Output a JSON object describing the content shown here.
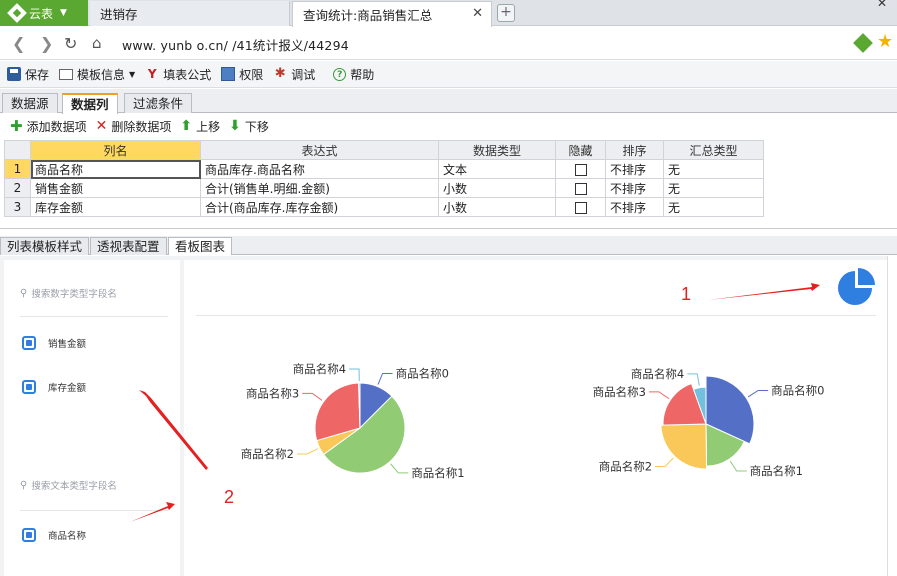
{
  "browser": {
    "app_name": "云表",
    "tabs": [
      {
        "label": "进销存"
      },
      {
        "label": "查询统计:商品销售汇总"
      }
    ],
    "url": "www.    yunb    o.cn/    /41统计报义/44294"
  },
  "toolbar": {
    "save": "保存",
    "template_info": "模板信息",
    "fill_formula": "填表公式",
    "permissions": "权限",
    "debug": "调试",
    "help": "帮助"
  },
  "design_tabs": [
    "数据源",
    "数据列",
    "过滤条件"
  ],
  "column_actions": {
    "add": "添加数据项",
    "delete": "删除数据项",
    "move_up": "上移",
    "move_down": "下移"
  },
  "grid": {
    "headers": [
      "列名",
      "表达式",
      "数据类型",
      "隐藏",
      "排序",
      "汇总类型"
    ],
    "rows": [
      {
        "num": "1",
        "name": "商品名称",
        "expr": "商品库存.商品名称",
        "type": "文本",
        "sort": "不排序",
        "agg": "无"
      },
      {
        "num": "2",
        "name": "销售金额",
        "expr": "合计(销售单.明细.金额)",
        "type": "小数",
        "sort": "不排序",
        "agg": "无"
      },
      {
        "num": "3",
        "name": "库存金额",
        "expr": "合计(商品库存.库存金额)",
        "type": "小数",
        "sort": "不排序",
        "agg": "无"
      }
    ]
  },
  "bottom_tabs": [
    "列表模板样式",
    "透视表配置",
    "看板图表"
  ],
  "board": {
    "numeric_search_placeholder": "搜索数字类型字段名",
    "numeric_fields": [
      "销售金额",
      "库存金额"
    ],
    "text_search_placeholder": "搜索文本类型字段名",
    "text_fields": [
      "商品名称"
    ]
  },
  "annotations": [
    "1",
    "2"
  ],
  "colors": {
    "accent_green": "#5aa832",
    "pie_blue": "#5470c6",
    "pie_green": "#91cc75",
    "pie_yellow": "#fac858",
    "pie_red": "#ee6666",
    "pie_cyan": "#73c0de",
    "icon_blue": "#2f7fe0",
    "annotation_red": "#e42020"
  },
  "chart_data": [
    {
      "type": "pie",
      "categories": [
        "商品名称0",
        "商品名称1",
        "商品名称2",
        "商品名称3",
        "商品名称4"
      ],
      "values": [
        12.5,
        52.5,
        5.5,
        29,
        0.5
      ]
    },
    {
      "type": "pie",
      "categories": [
        "商品名称0",
        "商品名称1",
        "商品名称2",
        "商品名称3",
        "商品名称4"
      ],
      "values": [
        31.8,
        18,
        24.8,
        19.9,
        5.5
      ]
    }
  ]
}
